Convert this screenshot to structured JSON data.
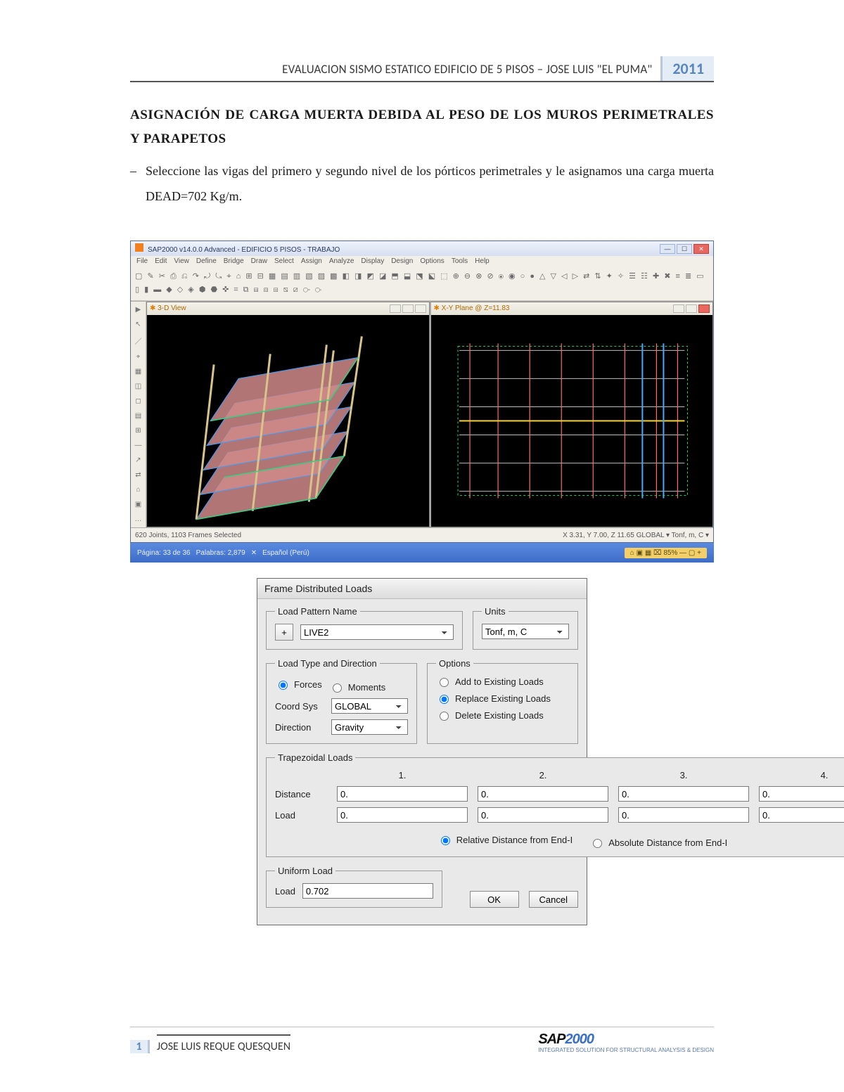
{
  "header": {
    "running_title": "EVALUACION SISMO ESTATICO EDIFICIO DE 5 PISOS – JOSE LUIS \"EL PUMA\"",
    "year": "2011"
  },
  "section": {
    "title": "ASIGNACIÓN DE CARGA MUERTA DEBIDA AL PESO DE LOS MUROS PERIMETRALES Y PARAPETOS",
    "bullet_1": "Seleccione las vigas del primero y segundo nivel de los pórticos perimetrales y le asignamos una carga muerta DEAD=702 Kg/m."
  },
  "sap_window": {
    "title": "SAP2000 v14.0.0 Advanced - EDIFICIO 5 PISOS - TRABAJO",
    "menus": [
      "File",
      "Edit",
      "View",
      "Define",
      "Bridge",
      "Draw",
      "Select",
      "Assign",
      "Analyze",
      "Display",
      "Design",
      "Options",
      "Tools",
      "Help"
    ],
    "toolbars_glyphs": "▢ ✎ ✂ ⎙ ⎌ ↷ ⤾ ⤿ ⌖ ⌂ ⊞ ⊟ ▦ ▤ ▥ ▧ ▨ ▩ ◧ ◨ ◩ ◪ ⬒ ⬓ ⬔ ⬕ ⬚ ⊕ ⊖ ⊗ ⊘ ⦿ ◉ ○ ● △ ▽ ◁ ▷ ⇄ ⇅ ✦ ✧ ☰ ☷ ✚ ✖ ≡ ≣ ▭ ▯ ▮ ▬ ◆ ◇ ◈ ⬢ ⬣ ✜ ⌗ ⧉ ⧈ ⧇ ⧆ ⧅ ⧄ ⧃ ⧂",
    "sidetool_glyphs": [
      "▶",
      "↖",
      "／",
      "⌖",
      "▦",
      "◫",
      "◻",
      "▤",
      "⊞",
      "—",
      "↗",
      "⇄",
      "⌂",
      "▣",
      "…"
    ],
    "view_left": {
      "title": "3-D View",
      "winbtns": [
        "—",
        "☐",
        "✕"
      ]
    },
    "view_right": {
      "title": "X-Y Plane @ Z=11.83",
      "winbtns": [
        "—",
        "☐",
        "✕"
      ]
    },
    "status_left": "620 Joints, 1103 Frames Selected",
    "status_right": "X 3.31, Y 7.00, Z 11.65   GLOBAL   ▾   Tonf, m, C   ▾"
  },
  "taskbar": {
    "left_items": [
      "Página: 33 de 36",
      "Palabras: 2,879",
      "✕",
      "Español (Perú)"
    ],
    "tray": "⌂ ▣ ▦ ⌧   85%   —   ▢   +"
  },
  "dialog": {
    "title": "Frame Distributed Loads",
    "groups": {
      "load_pattern": {
        "legend": "Load Pattern Name",
        "add_btn": "+",
        "value": "LIVE2"
      },
      "units": {
        "legend": "Units",
        "value": "Tonf, m, C"
      },
      "load_type": {
        "legend": "Load Type and Direction",
        "forces": "Forces",
        "moments": "Moments",
        "coord_sys_label": "Coord Sys",
        "coord_sys_value": "GLOBAL",
        "direction_label": "Direction",
        "direction_value": "Gravity"
      },
      "options": {
        "legend": "Options",
        "add": "Add to Existing Loads",
        "replace": "Replace Existing Loads",
        "delete": "Delete Existing Loads"
      },
      "trapezoidal": {
        "legend": "Trapezoidal Loads",
        "cols": [
          "1.",
          "2.",
          "3.",
          "4."
        ],
        "distance_label": "Distance",
        "distance": [
          "0.",
          "0.",
          "0.",
          "0."
        ],
        "load_label": "Load",
        "load": [
          "0.",
          "0.",
          "0.",
          "0."
        ],
        "relative": "Relative Distance from End-I",
        "absolute": "Absolute Distance from End-I"
      },
      "uniform": {
        "legend": "Uniform Load",
        "load_label": "Load",
        "load_value": "0.702"
      }
    },
    "buttons": {
      "ok": "OK",
      "cancel": "Cancel"
    }
  },
  "footer": {
    "page_number": "1",
    "author": "JOSE LUIS REQUE QUESQUEN",
    "logo_main": "SAP",
    "logo_year": "2000",
    "logo_sub": "INTEGRATED SOLUTION FOR STRUCTURAL ANALYSIS & DESIGN"
  }
}
